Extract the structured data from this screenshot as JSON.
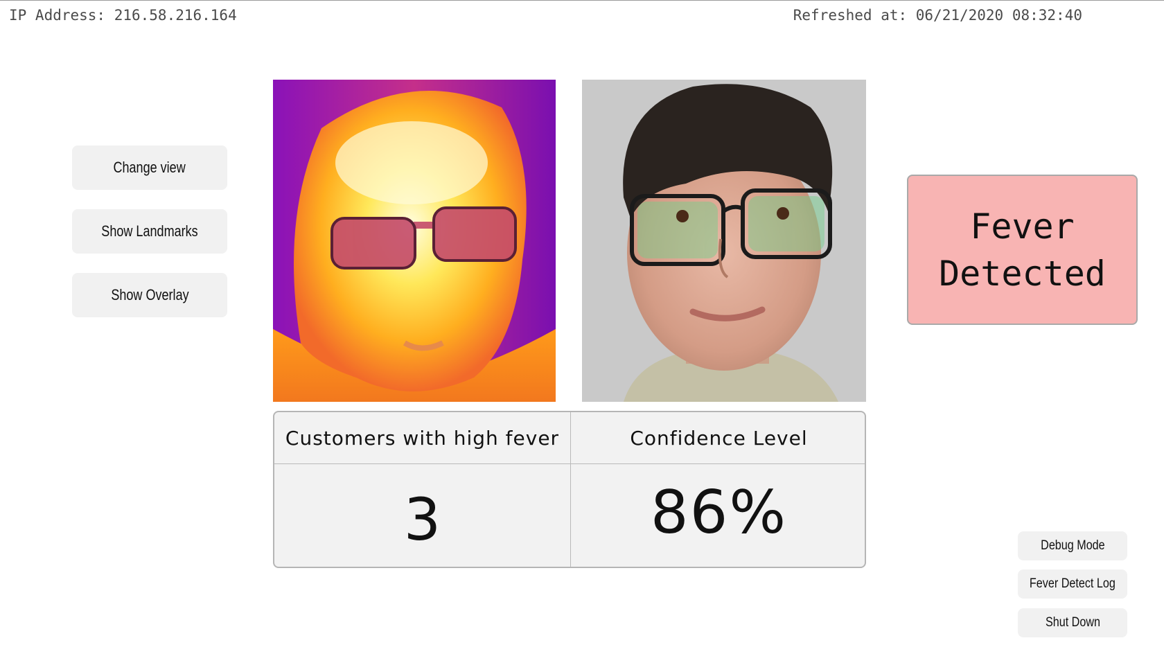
{
  "header": {
    "ip_address": "IP Address: 216.58.216.164",
    "refreshed": "Refreshed at: 06/21/2020 08:32:40"
  },
  "left_controls": [
    {
      "label": "Change view"
    },
    {
      "label": "Show Landmarks"
    },
    {
      "label": "Show Overlay"
    }
  ],
  "stats": {
    "high_fever_label": "Customers with high fever",
    "high_fever_value": "3",
    "confidence_label": "Confidence Level",
    "confidence_value": "86%"
  },
  "alert": {
    "line1": "Fever",
    "line2": "Detected",
    "color": "#f8b4b3"
  },
  "right_controls": [
    {
      "label": "Debug Mode"
    },
    {
      "label": "Fever Detect Log"
    },
    {
      "label": "Shut Down"
    }
  ],
  "images": {
    "thermal": "thermal-camera-feed",
    "rgb": "rgb-camera-feed"
  }
}
